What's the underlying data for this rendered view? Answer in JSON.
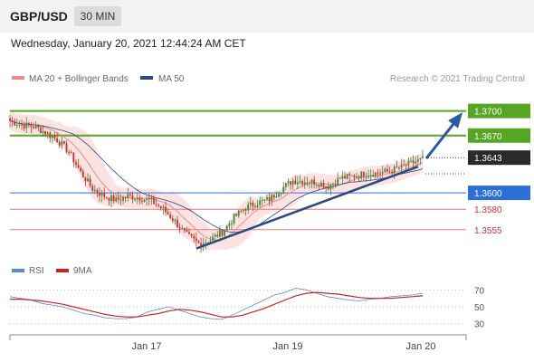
{
  "header": {
    "pair": "GBP/USD",
    "timeframe": "30 MIN"
  },
  "datetime": "Wednesday, January 20, 2021 12:44:24 AM CET",
  "legend": {
    "bb": "MA 20 + Bollinger Bands",
    "ma50": "MA 50",
    "rsi": "RSI",
    "rsi_ma": "9MA",
    "copyright": "Research © 2021 Trading Central"
  },
  "colors": {
    "up": "#3c8b3c",
    "down": "#c0392b",
    "bb_band": "#fde2e2",
    "bb_mid": "#f08a8a",
    "ma50": "#2c4a80",
    "green_level": "#56a623",
    "blue_level": "#2c6fd6",
    "red_level": "#e07a7a",
    "trend": "#2c4a80",
    "rsi": "#5b87d6",
    "rsi_ma": "#cc2222"
  },
  "chart_data": [
    {
      "type": "candlestick",
      "title": "GBP/USD 30 MIN",
      "ylim": [
        1.3515,
        1.3725
      ],
      "xlabels": [
        "Jan 17",
        "Jan 19",
        "Jan 20"
      ],
      "current_price": "1.3643",
      "levels": [
        {
          "label": "1.3700",
          "value": 1.37,
          "kind": "resistance"
        },
        {
          "label": "1.3670",
          "value": 1.367,
          "kind": "resistance"
        },
        {
          "label": "1.3600",
          "value": 1.36,
          "kind": "pivot"
        },
        {
          "label": "1.3580",
          "value": 1.358,
          "kind": "support"
        },
        {
          "label": "1.3555",
          "value": 1.3555,
          "kind": "support"
        }
      ],
      "price_path": [
        [
          0,
          1.3688
        ],
        [
          5,
          1.3683
        ],
        [
          10,
          1.3681
        ],
        [
          15,
          1.3674
        ],
        [
          20,
          1.3665
        ],
        [
          25,
          1.365
        ],
        [
          30,
          1.3625
        ],
        [
          35,
          1.3605
        ],
        [
          40,
          1.3596
        ],
        [
          45,
          1.3591
        ],
        [
          50,
          1.3596
        ],
        [
          55,
          1.3594
        ],
        [
          60,
          1.359
        ],
        [
          65,
          1.358
        ],
        [
          70,
          1.3565
        ],
        [
          75,
          1.3548
        ],
        [
          80,
          1.3538
        ],
        [
          85,
          1.3543
        ],
        [
          90,
          1.3552
        ],
        [
          95,
          1.357
        ],
        [
          100,
          1.3582
        ],
        [
          105,
          1.3588
        ],
        [
          110,
          1.3592
        ],
        [
          115,
          1.3605
        ],
        [
          120,
          1.3615
        ],
        [
          125,
          1.3614
        ],
        [
          130,
          1.3613
        ],
        [
          135,
          1.3608
        ],
        [
          140,
          1.3618
        ],
        [
          145,
          1.362
        ],
        [
          150,
          1.3623
        ],
        [
          155,
          1.3624
        ],
        [
          160,
          1.3626
        ],
        [
          165,
          1.363
        ],
        [
          170,
          1.3636
        ],
        [
          175,
          1.3641
        ]
      ]
    },
    {
      "type": "line",
      "title": "RSI",
      "ylim": [
        20,
        80
      ],
      "ticks": [
        70,
        50,
        30
      ],
      "series": [
        {
          "name": "RSI",
          "values": [
            62,
            60,
            58,
            54,
            52,
            50,
            46,
            42,
            40,
            37,
            36,
            36,
            38,
            44,
            47,
            50,
            46,
            42,
            38,
            36,
            35,
            40,
            46,
            52,
            58,
            64,
            67,
            72,
            70,
            66,
            62,
            60,
            58,
            57,
            59,
            60,
            62,
            63,
            64,
            66
          ]
        },
        {
          "name": "9MA",
          "values": [
            59,
            59,
            58,
            57,
            55,
            53,
            50,
            47,
            44,
            41,
            39,
            38,
            38,
            40,
            42,
            45,
            47,
            46,
            44,
            41,
            38,
            38,
            40,
            44,
            48,
            53,
            58,
            63,
            66,
            67,
            66,
            65,
            63,
            61,
            60,
            60,
            60,
            61,
            62,
            63
          ]
        }
      ]
    }
  ]
}
